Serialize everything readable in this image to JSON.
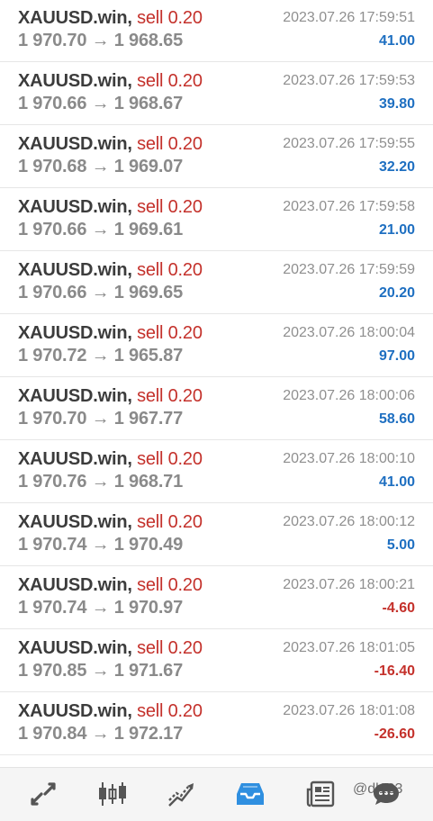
{
  "deals": [
    {
      "symbol": "XAUUSD.win,",
      "type": "sell 0.20",
      "prices": "1 970.70 → 1 968.65",
      "time": "2023.07.26 17:59:51",
      "profit": "41.00",
      "sign": "pos"
    },
    {
      "symbol": "XAUUSD.win,",
      "type": "sell 0.20",
      "prices": "1 970.66 → 1 968.67",
      "time": "2023.07.26 17:59:53",
      "profit": "39.80",
      "sign": "pos"
    },
    {
      "symbol": "XAUUSD.win,",
      "type": "sell 0.20",
      "prices": "1 970.68 → 1 969.07",
      "time": "2023.07.26 17:59:55",
      "profit": "32.20",
      "sign": "pos"
    },
    {
      "symbol": "XAUUSD.win,",
      "type": "sell 0.20",
      "prices": "1 970.66 → 1 969.61",
      "time": "2023.07.26 17:59:58",
      "profit": "21.00",
      "sign": "pos"
    },
    {
      "symbol": "XAUUSD.win,",
      "type": "sell 0.20",
      "prices": "1 970.66 → 1 969.65",
      "time": "2023.07.26 17:59:59",
      "profit": "20.20",
      "sign": "pos"
    },
    {
      "symbol": "XAUUSD.win,",
      "type": "sell 0.20",
      "prices": "1 970.72 → 1 965.87",
      "time": "2023.07.26 18:00:04",
      "profit": "97.00",
      "sign": "pos"
    },
    {
      "symbol": "XAUUSD.win,",
      "type": "sell 0.20",
      "prices": "1 970.70 → 1 967.77",
      "time": "2023.07.26 18:00:06",
      "profit": "58.60",
      "sign": "pos"
    },
    {
      "symbol": "XAUUSD.win,",
      "type": "sell 0.20",
      "prices": "1 970.76 → 1 968.71",
      "time": "2023.07.26 18:00:10",
      "profit": "41.00",
      "sign": "pos"
    },
    {
      "symbol": "XAUUSD.win,",
      "type": "sell 0.20",
      "prices": "1 970.74 → 1 970.49",
      "time": "2023.07.26 18:00:12",
      "profit": "5.00",
      "sign": "pos"
    },
    {
      "symbol": "XAUUSD.win,",
      "type": "sell 0.20",
      "prices": "1 970.74 → 1 970.97",
      "time": "2023.07.26 18:00:21",
      "profit": "-4.60",
      "sign": "neg"
    },
    {
      "symbol": "XAUUSD.win,",
      "type": "sell 0.20",
      "prices": "1 970.85 → 1 971.67",
      "time": "2023.07.26 18:01:05",
      "profit": "-16.40",
      "sign": "neg"
    },
    {
      "symbol": "XAUUSD.win,",
      "type": "sell 0.20",
      "prices": "1 970.84 → 1 972.17",
      "time": "2023.07.26 18:01:08",
      "profit": "-26.60",
      "sign": "neg"
    }
  ],
  "nav": {
    "items": [
      {
        "icon": "quotes-icon",
        "active": false
      },
      {
        "icon": "chart-icon",
        "active": false
      },
      {
        "icon": "trade-icon",
        "active": false
      },
      {
        "icon": "history-icon",
        "active": true
      },
      {
        "icon": "news-icon",
        "active": false
      },
      {
        "icon": "chat-icon",
        "active": false
      }
    ],
    "watermark": "@dl123"
  },
  "colors": {
    "positive": "#1e6fc1",
    "negative": "#c4312b",
    "active_icon": "#2f8fe0",
    "icon": "#555555"
  }
}
